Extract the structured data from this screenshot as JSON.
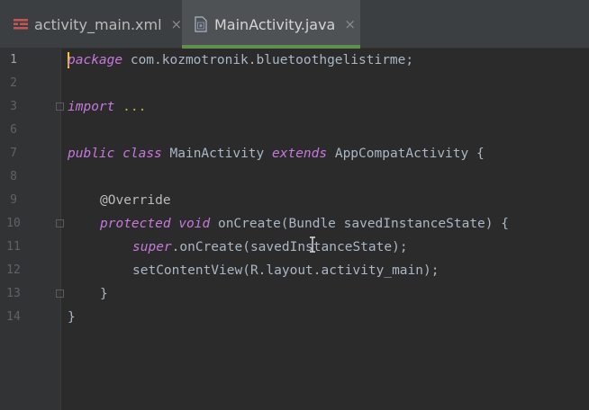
{
  "tabs": [
    {
      "label": "activity_main.xml",
      "icon": "layout-xml-icon",
      "active": false
    },
    {
      "label": "MainActivity.java",
      "icon": "java-class-icon",
      "active": true
    }
  ],
  "close_glyph": "×",
  "colors": {
    "background": "#2b2b2b",
    "keyword": "#c679dd",
    "text": "#a9b7c6",
    "annotation": "#bbb529",
    "active_tab_underline": "#5f8f4e",
    "caret": "#ffcc00"
  },
  "line_numbers": [
    "1",
    "2",
    "3",
    "6",
    "7",
    "8",
    "9",
    "10",
    "11",
    "12",
    "13",
    "14"
  ],
  "code": {
    "l1_kw": "package",
    "l1_rest": " com.kozmotronik.bluetoothgelistirme;",
    "l3_kw": "import",
    "l3_rest": " ...",
    "l7_kw1": "public",
    "l7_kw2": "class",
    "l7_name": " MainActivity ",
    "l7_kw3": "extends",
    "l7_rest": " AppCompatActivity {",
    "l9_ann": "@Override",
    "l10_kw1": "protected",
    "l10_kw2": "void",
    "l10_rest": " onCreate(Bundle savedInstanceState) {",
    "l11_kw": "super",
    "l11_rest": ".onCreate(savedInstanceState);",
    "l12_rest": "setContentView(R.layout.activity_main);",
    "l13": "}",
    "l14": "}"
  }
}
